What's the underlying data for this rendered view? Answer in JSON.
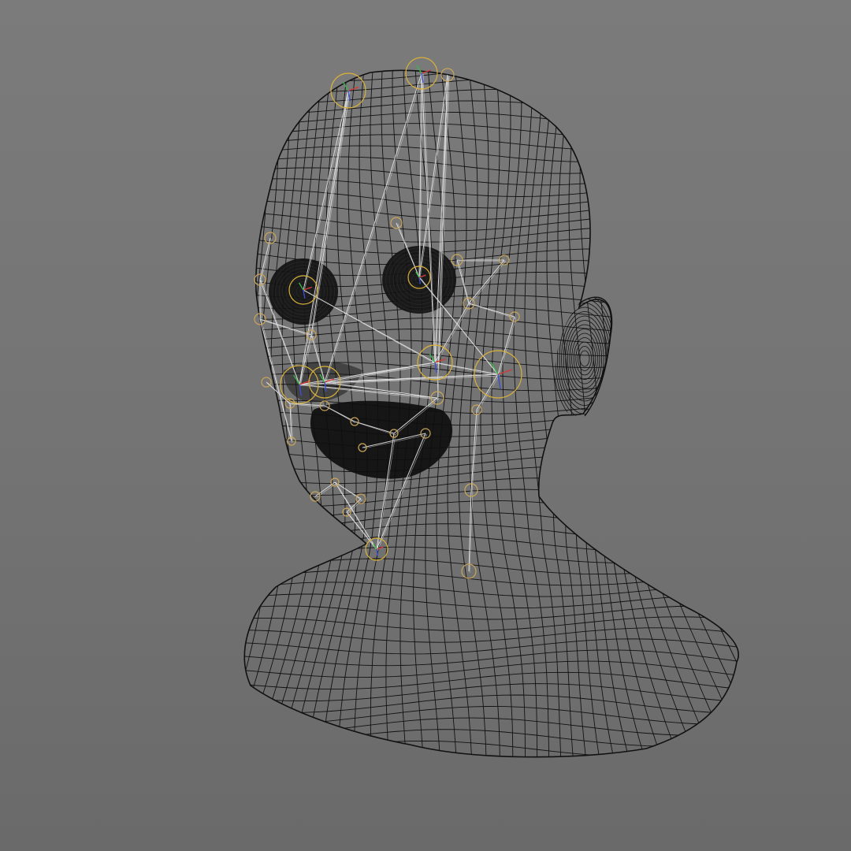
{
  "viewport": {
    "background_top": "#7b7b7b",
    "background_bottom": "#6a6a6a",
    "mesh_color": "#111111",
    "rig_line_color": "#e8e8e8",
    "control_ring_color": "#d8b13a",
    "joint_ring_color": "#c9a65a",
    "axis_x_color": "#d23a3a",
    "axis_y_color": "#3ab54a",
    "axis_z_color": "#3a4ed2"
  },
  "scene": {
    "object": "head-bust-wireframe",
    "rig_controls": "facial-joint-rig"
  }
}
